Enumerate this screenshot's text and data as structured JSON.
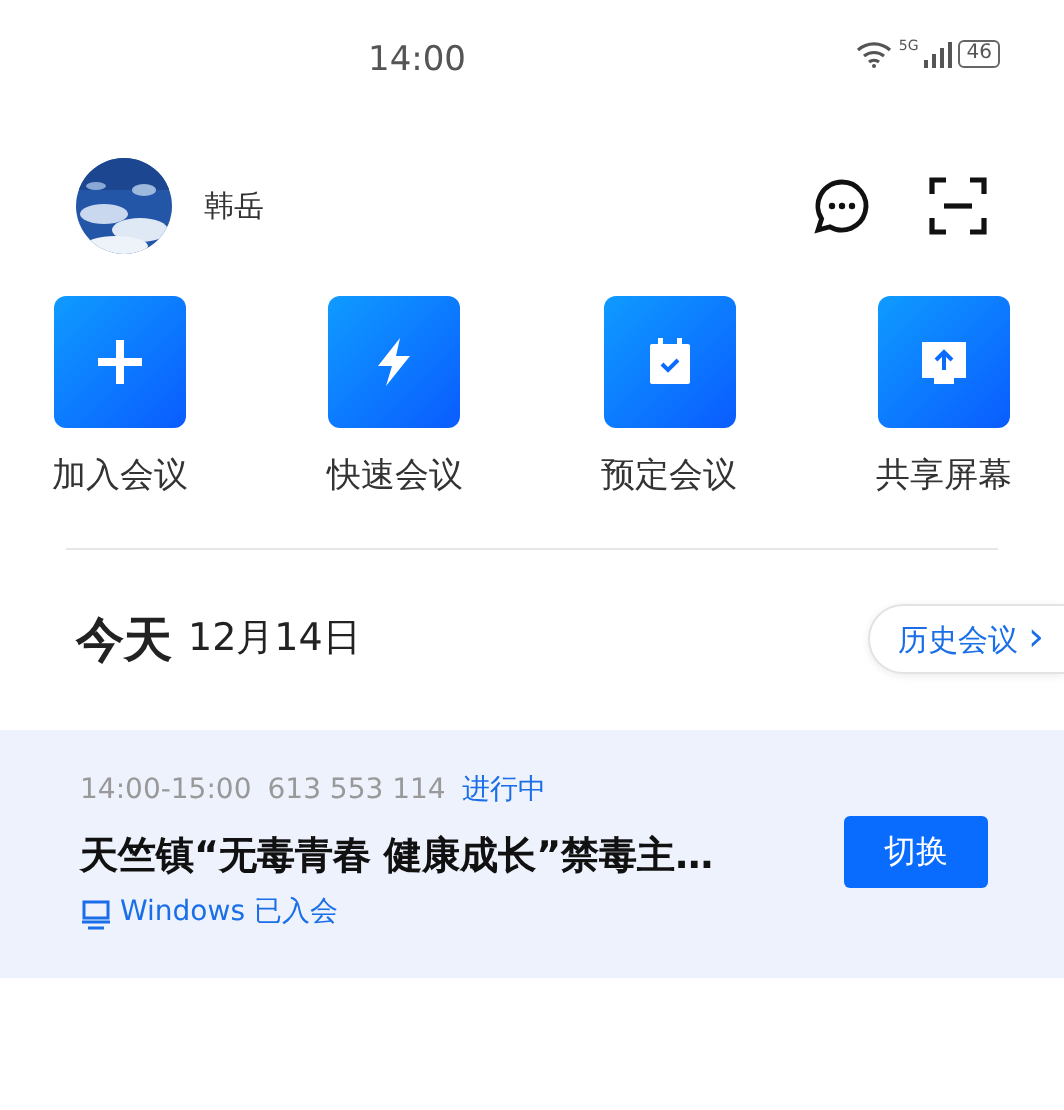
{
  "status_bar": {
    "time": "14:00",
    "network": "5G",
    "battery": "46"
  },
  "profile": {
    "name": "韩岳"
  },
  "actions": [
    {
      "kind": "join",
      "label": "加入会议"
    },
    {
      "kind": "quick",
      "label": "快速会议"
    },
    {
      "kind": "schedule",
      "label": "预定会议"
    },
    {
      "kind": "share",
      "label": "共享屏幕"
    }
  ],
  "today": {
    "title": "今天",
    "date": "12月14日",
    "history_button": "历史会议",
    "history_chevron": "›"
  },
  "meetings": [
    {
      "time": "14:00-15:00",
      "meeting_id": "613 553 114",
      "status": "进行中",
      "title": "天竺镇“无毒青春 健康成长”禁毒主…",
      "device": "Windows 已入会",
      "button": "切换"
    }
  ]
}
